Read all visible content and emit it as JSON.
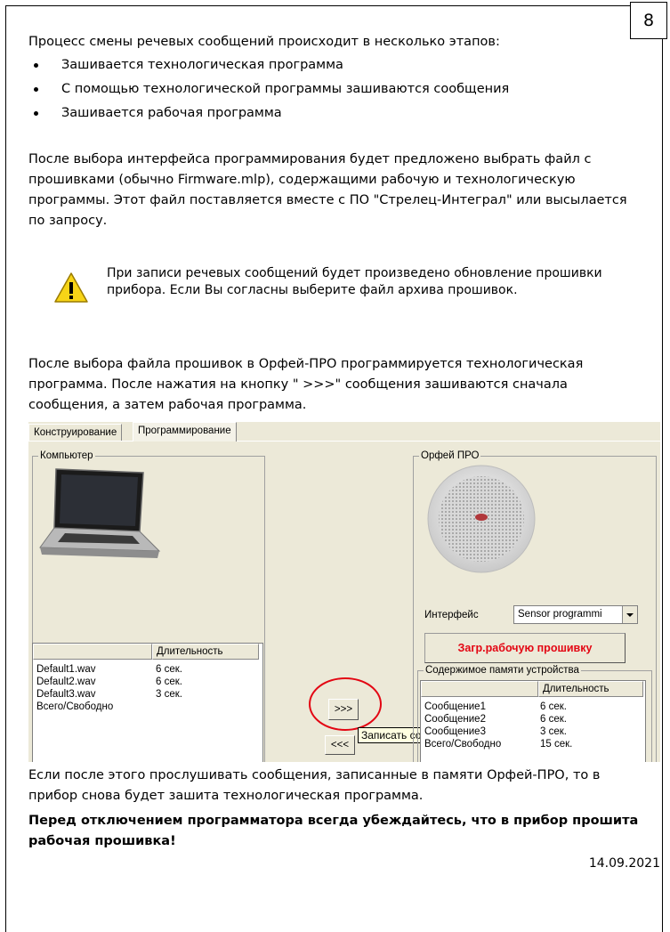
{
  "page_number": "8",
  "intro": "Процесс смены речевых сообщений происходит в несколько этапов:",
  "bullets": [
    "Зашивается технологическая программа",
    "С помощью технологической программы зашиваются сообщения",
    "Зашивается рабочая программа"
  ],
  "para1": "После выбора интерфейса программирования будет предложено выбрать файл с прошивками (обычно Firmware.mlp), содержащими рабочую и технологическую программы. Этот файл поставляется вместе с ПО \"Стрелец-Интеграл\" или высылается по запросу.",
  "warning": "При записи речевых сообщений будет произведено обновление прошивки прибора. Если Вы согласны выберите файл архива прошивок.",
  "para2": "После выбора файла прошивок в Орфей-ПРО программируется технологическая программа. После нажатия на кнопку \" >>>\" сообщения зашиваются сначала сообщения, а затем рабочая программа.",
  "screenshot": {
    "tabs": [
      "Конструирование",
      "Программирование"
    ],
    "computer_group": "Компьютер",
    "device_group": "Орфей ПРО",
    "interface_label": "Интерфейс",
    "interface_value": "Sensor programmi",
    "load_button": "Загр.рабочую прошивку",
    "memory_group": "Содержимое памяти устройства",
    "duration_header": "Длительность",
    "computer_rows": [
      {
        "name": "Default1.wav",
        "dur": "6 сек."
      },
      {
        "name": "Default2.wav",
        "dur": "6 сек."
      },
      {
        "name": "Default3.wav",
        "dur": "3 сек."
      },
      {
        "name": "Всего/Свободно",
        "dur": ""
      }
    ],
    "device_rows": [
      {
        "name": "Сообщение1",
        "dur": "6 сек."
      },
      {
        "name": "Сообщение2",
        "dur": "6 сек."
      },
      {
        "name": "Сообщение3",
        "dur": "3 сек."
      },
      {
        "name": "Всего/Свободно",
        "dur": "15 сек."
      }
    ],
    "forward_button": ">>>",
    "back_button": "<<<",
    "tooltip": "Записать сообщения в устройство",
    "highlight_color": "#e30613"
  },
  "para3": "Если после этого прослушивать сообщения, записанные в памяти Орфей-ПРО, то в прибор снова будет зашита технологическая программа.",
  "notice": "Перед отключением программатора всегда убеждайтесь, что в прибор прошита рабочая прошивка!",
  "date": "14.09.2021"
}
